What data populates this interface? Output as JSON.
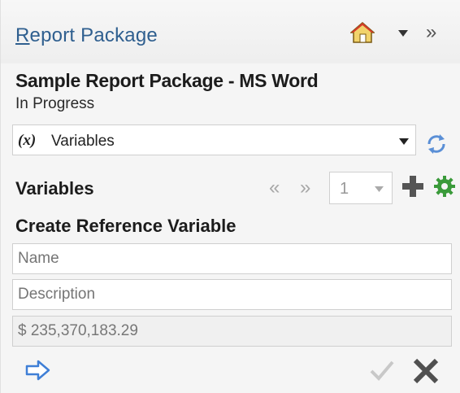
{
  "header": {
    "title_first_letter": "R",
    "title_rest": "eport Package"
  },
  "package": {
    "name": "Sample Report Package - MS Word",
    "status": "In Progress"
  },
  "view_select": {
    "icon_text": "(x)",
    "value": "Variables"
  },
  "variables_section": {
    "heading": "Variables",
    "page_value": "1"
  },
  "create_form": {
    "heading": "Create Reference Variable",
    "name_placeholder": "Name",
    "description_placeholder": "Description",
    "amount_value": "$ 235,370,183.29"
  },
  "icons": {
    "home": "home-icon",
    "dropdown": "chevron-down-icon",
    "more": "double-chevron-right-icon",
    "refresh": "refresh-icon",
    "prev": "double-chevron-left-icon",
    "next": "double-chevron-right-icon",
    "add": "plus-icon",
    "settings": "gear-icon",
    "go": "arrow-right-icon",
    "check": "check-icon",
    "close": "close-icon"
  },
  "colors": {
    "title": "#2f5f8f",
    "accent_blue": "#3f7fd6",
    "add_gray": "#555555",
    "gear_green": "#3a9a3a"
  }
}
